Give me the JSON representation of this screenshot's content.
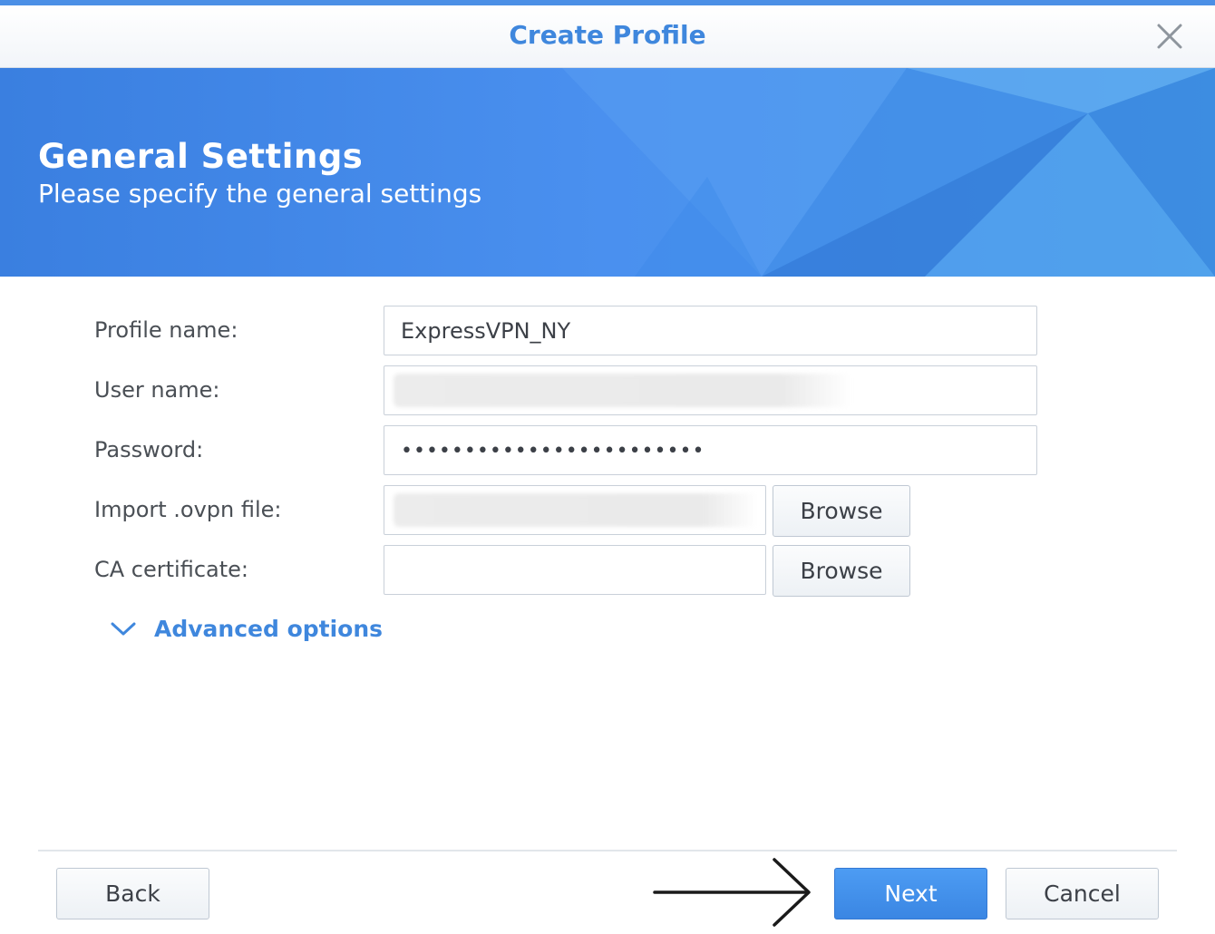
{
  "window": {
    "title": "Create Profile",
    "accent_color": "#3f87dd"
  },
  "banner": {
    "title": "General Settings",
    "subtitle": "Please specify the general settings",
    "color": "#3b83e6"
  },
  "form": {
    "profile_name": {
      "label": "Profile name:",
      "value": "ExpressVPN_NY"
    },
    "user_name": {
      "label": "User name:",
      "value": ""
    },
    "password": {
      "label": "Password:",
      "value": "••••••••••••••••••••••••"
    },
    "ovpn_file": {
      "label": "Import .ovpn file:",
      "value": "",
      "browse_label": "Browse"
    },
    "ca_certificate": {
      "label": "CA certificate:",
      "value": "",
      "browse_label": "Browse"
    },
    "advanced_options_label": "Advanced options"
  },
  "footer": {
    "back_label": "Back",
    "next_label": "Next",
    "cancel_label": "Cancel"
  },
  "icons": {
    "close": "close-icon",
    "chevron": "chevron-down-icon",
    "arrow": "arrow-right-icon"
  }
}
